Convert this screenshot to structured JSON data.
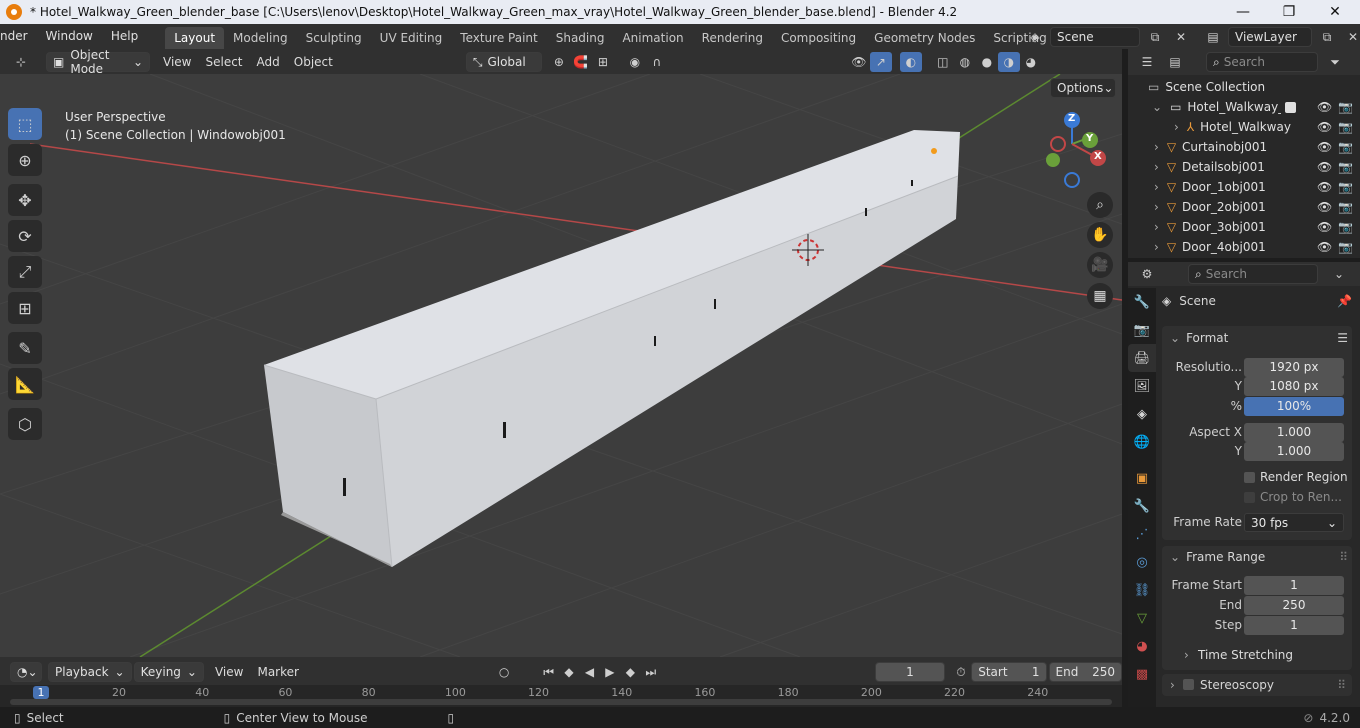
{
  "window": {
    "title": "* Hotel_Walkway_Green_blender_base [C:\\Users\\lenov\\Desktop\\Hotel_Walkway_Green_max_vray\\Hotel_Walkway_Green_blender_base.blend] - Blender 4.2",
    "minimize": "—",
    "maximize": "❐",
    "close": "✕"
  },
  "menu": [
    "nder",
    "Window",
    "Help"
  ],
  "workspaces": [
    "Layout",
    "Modeling",
    "Sculpting",
    "UV Editing",
    "Texture Paint",
    "Shading",
    "Animation",
    "Rendering",
    "Compositing",
    "Geometry Nodes",
    "Scripting"
  ],
  "add_workspace": "+",
  "scene_field": "Scene",
  "viewlayer_field": "ViewLayer",
  "viewport_header": {
    "mode": "Object Mode",
    "menus": [
      "View",
      "Select",
      "Add",
      "Object"
    ],
    "orientation": "Global",
    "options": "Options"
  },
  "viewport_overlay": {
    "perspective": "User Perspective",
    "collection_info": "(1) Scene Collection | Windowobj001"
  },
  "gizmo": {
    "z": "Z",
    "y": "Y",
    "x": "X"
  },
  "outliner": {
    "search_placeholder": "Search",
    "root": "Scene Collection",
    "collection": "Hotel_Walkway_Gre",
    "items": [
      "Hotel_Walkway",
      "Curtainobj001",
      "Detailsobj001",
      "Door_1obj001",
      "Door_2obj001",
      "Door_3obj001",
      "Door_4obj001"
    ]
  },
  "properties": {
    "search_placeholder": "Search",
    "context": "Scene",
    "format": {
      "title": "Format",
      "resolution_label": "Resolutio...",
      "resolution_x": "1920 px",
      "y_label": "Y",
      "resolution_y": "1080 px",
      "percent_label": "%",
      "percent": "100%",
      "aspect_x_label": "Aspect X",
      "aspect_x": "1.000",
      "aspect_y_label": "Y",
      "aspect_y": "1.000",
      "render_region": "Render Region",
      "crop": "Crop to Ren...",
      "frame_rate_label": "Frame Rate",
      "frame_rate": "30 fps"
    },
    "frame_range": {
      "title": "Frame Range",
      "start_label": "Frame Start",
      "start": "1",
      "end_label": "End",
      "end": "250",
      "step_label": "Step",
      "step": "1",
      "time_stretching": "Time Stretching"
    },
    "stereoscopy": "Stereoscopy"
  },
  "timeline": {
    "menus": [
      "Playback",
      "Keying",
      "View",
      "Marker"
    ],
    "current_frame": "1",
    "start_label": "Start",
    "start": "1",
    "end_label": "End",
    "end": "250",
    "ruler": [
      "1",
      "20",
      "40",
      "60",
      "80",
      "100",
      "120",
      "140",
      "160",
      "180",
      "200",
      "220",
      "240"
    ]
  },
  "statusbar": {
    "select": "Select",
    "center_view": "Center View to Mouse",
    "version": "4.2.0"
  },
  "colors": {
    "accent": "#4772b3",
    "titlebar": "#e9ecf3",
    "object": "#cfd2d8",
    "x_axis": "#c24747",
    "y_axis": "#6aa03a",
    "z_axis": "#3a7ad6"
  }
}
